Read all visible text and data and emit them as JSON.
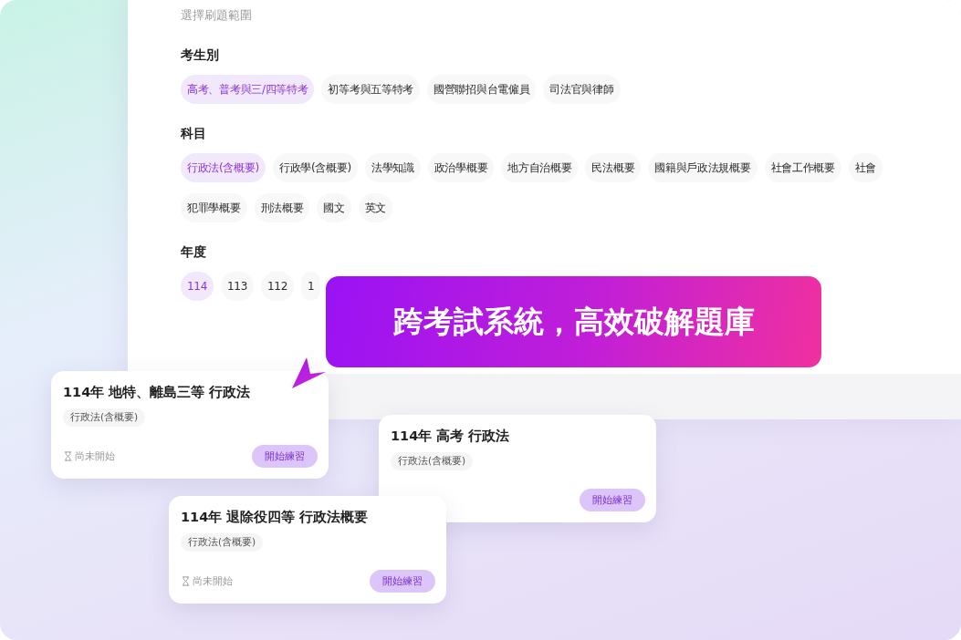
{
  "panel": {
    "heading": "選擇刷題範圍",
    "sections": [
      {
        "title": "考生別",
        "chips": [
          {
            "label": "高考、普考與三/四等特考",
            "selected": true
          },
          {
            "label": "初等考與五等特考",
            "selected": false
          },
          {
            "label": "國營聯招與台電僱員",
            "selected": false
          },
          {
            "label": "司法官與律師",
            "selected": false
          }
        ]
      },
      {
        "title": "科目",
        "chips": [
          {
            "label": "行政法(含概要)",
            "selected": true
          },
          {
            "label": "行政學(含概要)",
            "selected": false
          },
          {
            "label": "法學知識",
            "selected": false
          },
          {
            "label": "政治學概要",
            "selected": false
          },
          {
            "label": "地方自治概要",
            "selected": false
          },
          {
            "label": "民法概要",
            "selected": false
          },
          {
            "label": "國籍與戶政法規概要",
            "selected": false
          },
          {
            "label": "社會工作概要",
            "selected": false
          },
          {
            "label": "社會",
            "selected": false
          },
          {
            "label": "犯罪學概要",
            "selected": false
          },
          {
            "label": "刑法概要",
            "selected": false
          },
          {
            "label": "國文",
            "selected": false
          },
          {
            "label": "英文",
            "selected": false
          }
        ]
      },
      {
        "title": "年度",
        "chips": [
          {
            "label": "114",
            "selected": true
          },
          {
            "label": "113",
            "selected": false
          },
          {
            "label": "112",
            "selected": false
          },
          {
            "label": "1",
            "selected": false
          }
        ]
      }
    ]
  },
  "banner": "跨考試系統，高效破解題庫",
  "cards": [
    {
      "title": "114年 地特、離島三等 行政法",
      "tag": "行政法(含概要)",
      "status": "尚未開始",
      "button": "開始練習"
    },
    {
      "title": "114年 高考 行政法",
      "tag": "行政法(含概要)",
      "button": "開始練習"
    },
    {
      "title": "114年 退除役四等 行政法概要",
      "tag": "行政法(含概要)",
      "status": "尚未開始",
      "button": "開始練習"
    }
  ]
}
